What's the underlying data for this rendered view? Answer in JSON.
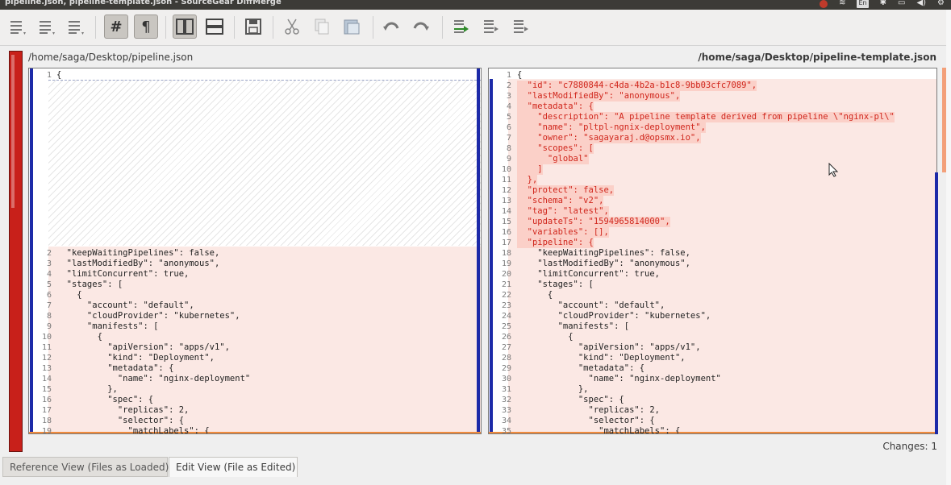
{
  "window": {
    "title": "pipeline.json, pipeline-template.json - SourceGear DiffMerge",
    "tray": {
      "lang": "En"
    }
  },
  "toolbar": {
    "buttons": [
      {
        "name": "first-change-icon"
      },
      {
        "name": "prev-change-icon"
      },
      {
        "name": "next-change-icon"
      },
      {
        "name": "line-numbers-icon",
        "glyph": "#",
        "active": true
      },
      {
        "name": "pilcrow-icon",
        "glyph": "¶",
        "active": true
      },
      {
        "name": "side-by-side-icon",
        "active": true
      },
      {
        "name": "top-bottom-icon"
      },
      {
        "name": "save-icon"
      },
      {
        "name": "cut-icon"
      },
      {
        "name": "copy-icon"
      },
      {
        "name": "paste-icon"
      },
      {
        "name": "undo-icon"
      },
      {
        "name": "redo-icon"
      },
      {
        "name": "apply-left-icon"
      },
      {
        "name": "apply-right-icon"
      },
      {
        "name": "apply-all-icon"
      }
    ]
  },
  "left_path": "/home/saga/Desktop/pipeline.json",
  "right_path": "/home/saga/Desktop/pipeline-template.json",
  "left_lines": [
    {
      "n": "1",
      "t": "{",
      "row": 0
    },
    {
      "n": "2",
      "t": "  \"keepWaitingPipelines\": false,",
      "row": 17
    },
    {
      "n": "3",
      "t": "  \"lastModifiedBy\": \"anonymous\",",
      "row": 18
    },
    {
      "n": "4",
      "t": "  \"limitConcurrent\": true,",
      "row": 19
    },
    {
      "n": "5",
      "t": "  \"stages\": [",
      "row": 20
    },
    {
      "n": "6",
      "t": "    {",
      "row": 21
    },
    {
      "n": "7",
      "t": "      \"account\": \"default\",",
      "row": 22
    },
    {
      "n": "8",
      "t": "      \"cloudProvider\": \"kubernetes\",",
      "row": 23
    },
    {
      "n": "9",
      "t": "      \"manifests\": [",
      "row": 24
    },
    {
      "n": "10",
      "t": "        {",
      "row": 25
    },
    {
      "n": "11",
      "t": "          \"apiVersion\": \"apps/v1\",",
      "row": 26
    },
    {
      "n": "12",
      "t": "          \"kind\": \"Deployment\",",
      "row": 27
    },
    {
      "n": "13",
      "t": "          \"metadata\": {",
      "row": 28
    },
    {
      "n": "14",
      "t": "            \"name\": \"nginx-deployment\"",
      "row": 29
    },
    {
      "n": "15",
      "t": "          },",
      "row": 30
    },
    {
      "n": "16",
      "t": "          \"spec\": {",
      "row": 31
    },
    {
      "n": "17",
      "t": "            \"replicas\": 2,",
      "row": 32
    },
    {
      "n": "18",
      "t": "            \"selector\": {",
      "row": 33
    },
    {
      "n": "19",
      "t": "              \"matchLabels\": {",
      "row": 34
    }
  ],
  "right_lines": [
    {
      "n": "1",
      "t": "{",
      "del": false
    },
    {
      "n": "2",
      "t": "  \"id\": \"c7880844-c4da-4b2a-b1c8-9bb03cfc7089\",",
      "del": true
    },
    {
      "n": "3",
      "t": "  \"lastModifiedBy\": \"anonymous\",",
      "del": true
    },
    {
      "n": "4",
      "t": "  \"metadata\": {",
      "del": true
    },
    {
      "n": "5",
      "t": "    \"description\": \"A pipeline template derived from pipeline \\\"nginx-pl\\\"",
      "del": true
    },
    {
      "n": "6",
      "t": "    \"name\": \"pltpl-ngnix-deployment\",",
      "del": true
    },
    {
      "n": "7",
      "t": "    \"owner\": \"sagayaraj.d@opsmx.io\",",
      "del": true
    },
    {
      "n": "8",
      "t": "    \"scopes\": [",
      "del": true
    },
    {
      "n": "9",
      "t": "      \"global\"",
      "del": true
    },
    {
      "n": "10",
      "t": "    ]",
      "del": true
    },
    {
      "n": "11",
      "t": "  },",
      "del": true
    },
    {
      "n": "12",
      "t": "  \"protect\": false,",
      "del": true
    },
    {
      "n": "13",
      "t": "  \"schema\": \"v2\",",
      "del": true
    },
    {
      "n": "14",
      "t": "  \"tag\": \"latest\",",
      "del": true
    },
    {
      "n": "15",
      "t": "  \"updateTs\": \"1594965814000\",",
      "del": true
    },
    {
      "n": "16",
      "t": "  \"variables\": [],",
      "del": true
    },
    {
      "n": "17",
      "t": "  \"pipeline\": {",
      "del": true
    },
    {
      "n": "18",
      "t": "    \"keepWaitingPipelines\": false,",
      "del": false
    },
    {
      "n": "19",
      "t": "    \"lastModifiedBy\": \"anonymous\",",
      "del": false
    },
    {
      "n": "20",
      "t": "    \"limitConcurrent\": true,",
      "del": false
    },
    {
      "n": "21",
      "t": "    \"stages\": [",
      "del": false
    },
    {
      "n": "22",
      "t": "      {",
      "del": false
    },
    {
      "n": "23",
      "t": "        \"account\": \"default\",",
      "del": false
    },
    {
      "n": "24",
      "t": "        \"cloudProvider\": \"kubernetes\",",
      "del": false
    },
    {
      "n": "25",
      "t": "        \"manifests\": [",
      "del": false
    },
    {
      "n": "26",
      "t": "          {",
      "del": false
    },
    {
      "n": "27",
      "t": "            \"apiVersion\": \"apps/v1\",",
      "del": false
    },
    {
      "n": "28",
      "t": "            \"kind\": \"Deployment\",",
      "del": false
    },
    {
      "n": "29",
      "t": "            \"metadata\": {",
      "del": false
    },
    {
      "n": "30",
      "t": "              \"name\": \"nginx-deployment\"",
      "del": false
    },
    {
      "n": "31",
      "t": "            },",
      "del": false
    },
    {
      "n": "32",
      "t": "            \"spec\": {",
      "del": false
    },
    {
      "n": "33",
      "t": "              \"replicas\": 2,",
      "del": false
    },
    {
      "n": "34",
      "t": "              \"selector\": {",
      "del": false
    },
    {
      "n": "35",
      "t": "                \"matchLabels\": {",
      "del": false
    }
  ],
  "status": {
    "changes": "Changes: 1"
  },
  "tabs": [
    {
      "label": "Reference View (Files as Loaded)",
      "active": false
    },
    {
      "label": "Edit View (File as Edited)",
      "active": true
    }
  ],
  "colors": {
    "accent_red": "#c8201a",
    "diff_pink": "#fbe8e4",
    "deleted_text": "#d0261c",
    "change_bar": "#1c2aa8"
  }
}
